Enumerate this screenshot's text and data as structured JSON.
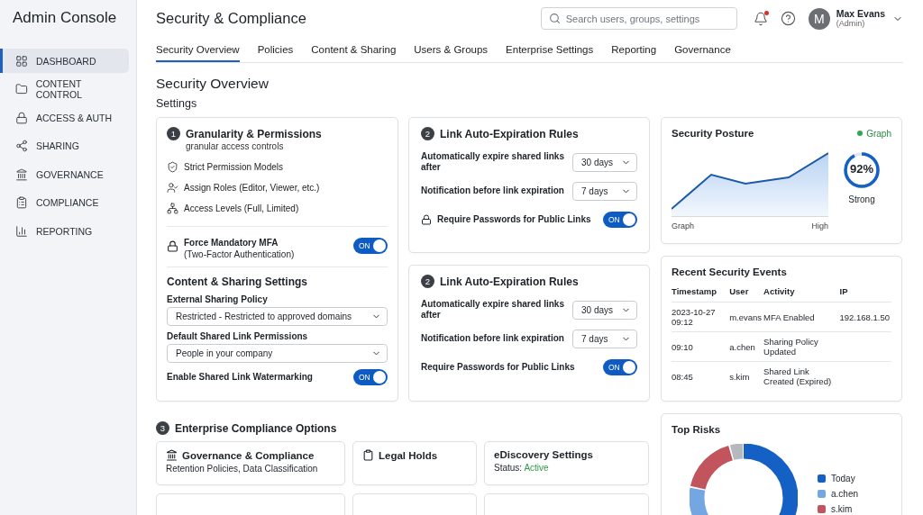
{
  "sidebar": {
    "title": "Admin Console",
    "items": [
      {
        "label": "DASHBOARD",
        "selected": true
      },
      {
        "label": "CONTENT CONTROL",
        "selected": false
      },
      {
        "label": "ACCESS & AUTH",
        "selected": false
      },
      {
        "label": "SHARING",
        "selected": false
      },
      {
        "label": "GOVERNANCE",
        "selected": false
      },
      {
        "label": "COMPLIANCE",
        "selected": false
      },
      {
        "label": "REPORTING",
        "selected": false
      }
    ]
  },
  "header": {
    "title": "Security & Compliance",
    "search": {
      "placeholder": "Search users, groups, settings"
    },
    "notifications": {
      "unread": true
    },
    "user": {
      "initial": "M",
      "name": "Max Evans",
      "role": "(Admin)"
    }
  },
  "tabs": [
    {
      "label": "Security Overview",
      "selected": true
    },
    {
      "label": "Policies",
      "selected": false
    },
    {
      "label": "Content & Sharing",
      "selected": false
    },
    {
      "label": "Users & Groups",
      "selected": false
    },
    {
      "label": "Enterprise Settings",
      "selected": false
    },
    {
      "label": "Reporting",
      "selected": false
    },
    {
      "label": "Governance",
      "selected": false
    }
  ],
  "page_title": "Security Overview",
  "section_title": "Settings",
  "granularity": {
    "number": "1",
    "title": "Granularity & Permissions",
    "subtitle": "granular access controls",
    "items": [
      "Strict Permission Models",
      "Assign Roles (Editor, Viewer, etc.)",
      "Access Levels (Full, Limited)"
    ],
    "mfa": {
      "label": "Force Mandatory MFA",
      "sublabel": "(Two-Factor Authentication)",
      "on": true,
      "state_label": "ON"
    }
  },
  "content_sharing": {
    "title": "Content & Sharing Settings",
    "fields": [
      {
        "label": "External Sharing Policy",
        "value": "Restricted - Restricted to approved domains"
      },
      {
        "label": "Default Shared Link Permissions",
        "value": "People in your company"
      }
    ],
    "watermark": {
      "label": "Enable Shared Link Watermarking",
      "on": true,
      "state_label": "ON"
    }
  },
  "link_rules": [
    {
      "number": "2",
      "title": "Link Auto-Expiration Rules",
      "rows": [
        {
          "kind": "select",
          "label": "Automatically expire shared links after",
          "value": "30 days"
        },
        {
          "kind": "select",
          "label": "Notification before link expiration",
          "value": "7 days"
        },
        {
          "kind": "locked-toggle",
          "label": "Require Passwords for Public Links",
          "on": true,
          "state_label": "ON"
        }
      ]
    },
    {
      "number": "2",
      "title": "Link Auto-Expiration Rules",
      "rows": [
        {
          "kind": "select",
          "label": "Automatically expire shared links after",
          "value": "30 days"
        },
        {
          "kind": "select",
          "label": "Notification before link expiration",
          "value": "7 days"
        },
        {
          "kind": "toggle",
          "label": "Require Passwords for Public Links",
          "on": true,
          "state_label": "ON"
        }
      ]
    }
  ],
  "compliance": {
    "number": "3",
    "title": "Enterprise Compliance Options",
    "cards": [
      {
        "kind": "governance",
        "title": "Governance & Compliance",
        "subtitle": "Retention Policies, Data Classification"
      },
      {
        "kind": "legal",
        "title": "Legal Holds"
      },
      {
        "kind": "status",
        "title": "eDiscovery Settings",
        "status_label": "Status:",
        "status": "Active"
      },
      {
        "kind": "empty"
      },
      {
        "kind": "empty"
      },
      {
        "kind": "empty"
      }
    ]
  },
  "posture": {
    "title": "Security Posture",
    "legend": "Graph",
    "x_start": "Graph",
    "x_end": "High",
    "score": "92%",
    "score_label": "Strong",
    "level": 0.92
  },
  "events": {
    "title": "Recent Security Events",
    "columns": [
      "Timestamp",
      "User",
      "Activity",
      "IP"
    ],
    "rows": [
      [
        "2023-10-27 09:12",
        "m.evans",
        "MFA Enabled",
        "192.168.1.50"
      ],
      [
        "09:10",
        "a.chen",
        "Sharing Policy Updated",
        ""
      ],
      [
        "08:45",
        "s.kim",
        "Shared Link Created (Expired)",
        ""
      ]
    ]
  },
  "risks": {
    "title": "Top Risks",
    "legend": [
      {
        "label": "Today",
        "color": "#1460c4"
      },
      {
        "label": "a.chen",
        "color": "#74a6e2"
      },
      {
        "label": "s.kim",
        "color": "#c2545e"
      }
    ]
  }
}
